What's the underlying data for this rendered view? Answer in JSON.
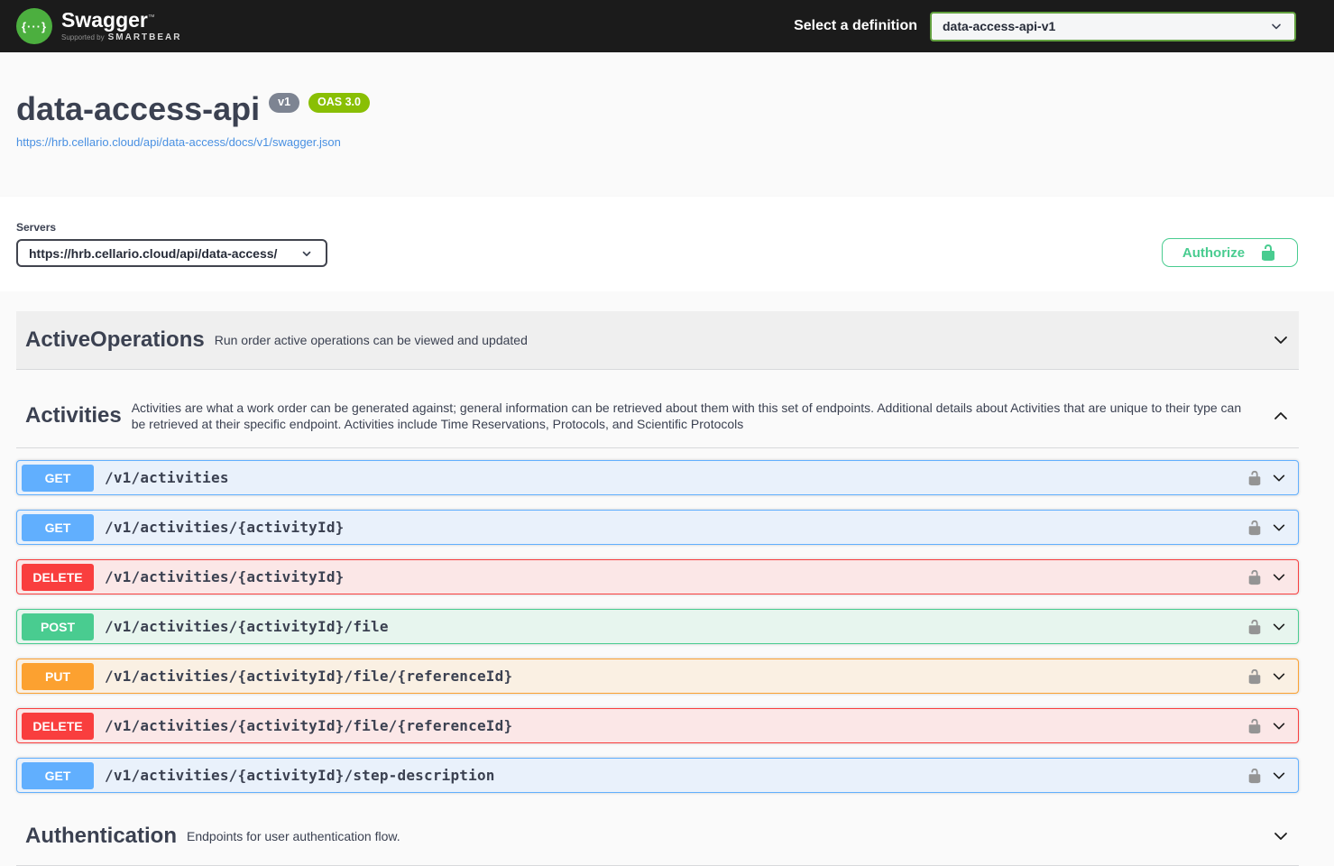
{
  "topbar": {
    "logo": {
      "text": "Swagger",
      "trademark": "™",
      "glyph": "{···}",
      "tagline_prefix": "Supported by",
      "tagline_brand": "SMARTBEAR"
    },
    "definition_label": "Select a definition",
    "definition_value": "data-access-api-v1"
  },
  "info": {
    "title": "data-access-api",
    "version_badge": "v1",
    "spec_badge": "OAS 3.0",
    "spec_url": "https://hrb.cellario.cloud/api/data-access/docs/v1/swagger.json"
  },
  "servers": {
    "label": "Servers",
    "value": "https://hrb.cellario.cloud/api/data-access/"
  },
  "authorize": {
    "label": "Authorize"
  },
  "sections": [
    {
      "title": "ActiveOperations",
      "description": "Run order active operations can be viewed and updated",
      "expanded": false
    },
    {
      "title": "Activities",
      "description": "Activities are what a work order can be generated against; general information can be retrieved about them with this set of endpoints. Additional details about Activities that are unique to their type can be retrieved at their specific endpoint. Activities include Time Reservations, Protocols, and Scientific Protocols",
      "expanded": true,
      "endpoints": [
        {
          "method": "GET",
          "path": "/v1/activities"
        },
        {
          "method": "GET",
          "path": "/v1/activities/{activityId}"
        },
        {
          "method": "DELETE",
          "path": "/v1/activities/{activityId}"
        },
        {
          "method": "POST",
          "path": "/v1/activities/{activityId}/file"
        },
        {
          "method": "PUT",
          "path": "/v1/activities/{activityId}/file/{referenceId}"
        },
        {
          "method": "DELETE",
          "path": "/v1/activities/{activityId}/file/{referenceId}"
        },
        {
          "method": "GET",
          "path": "/v1/activities/{activityId}/step-description"
        }
      ]
    },
    {
      "title": "Authentication",
      "description": "Endpoints for user authentication flow.",
      "expanded": false
    }
  ],
  "icons": {
    "logo": "swagger-braces-icon",
    "selects": "chevron-down-icon",
    "expanded_section": "chevron-up-icon",
    "collapsed_section": "chevron-down-icon",
    "auth": "unlock-icon"
  },
  "colors": {
    "topbar_bg": "#1b1b1b",
    "logo_green": "#4caf3f",
    "select_border_green": "#62a03f",
    "version_badge": "#7d8492",
    "oas_badge": "#89bf04",
    "link": "#4990e2",
    "authorize_green": "#49cc90",
    "get": "#61affe",
    "post": "#49cc90",
    "put": "#fca130",
    "delete": "#f93e3e",
    "text": "#3b4151",
    "row_lock_gray": "#949494"
  }
}
